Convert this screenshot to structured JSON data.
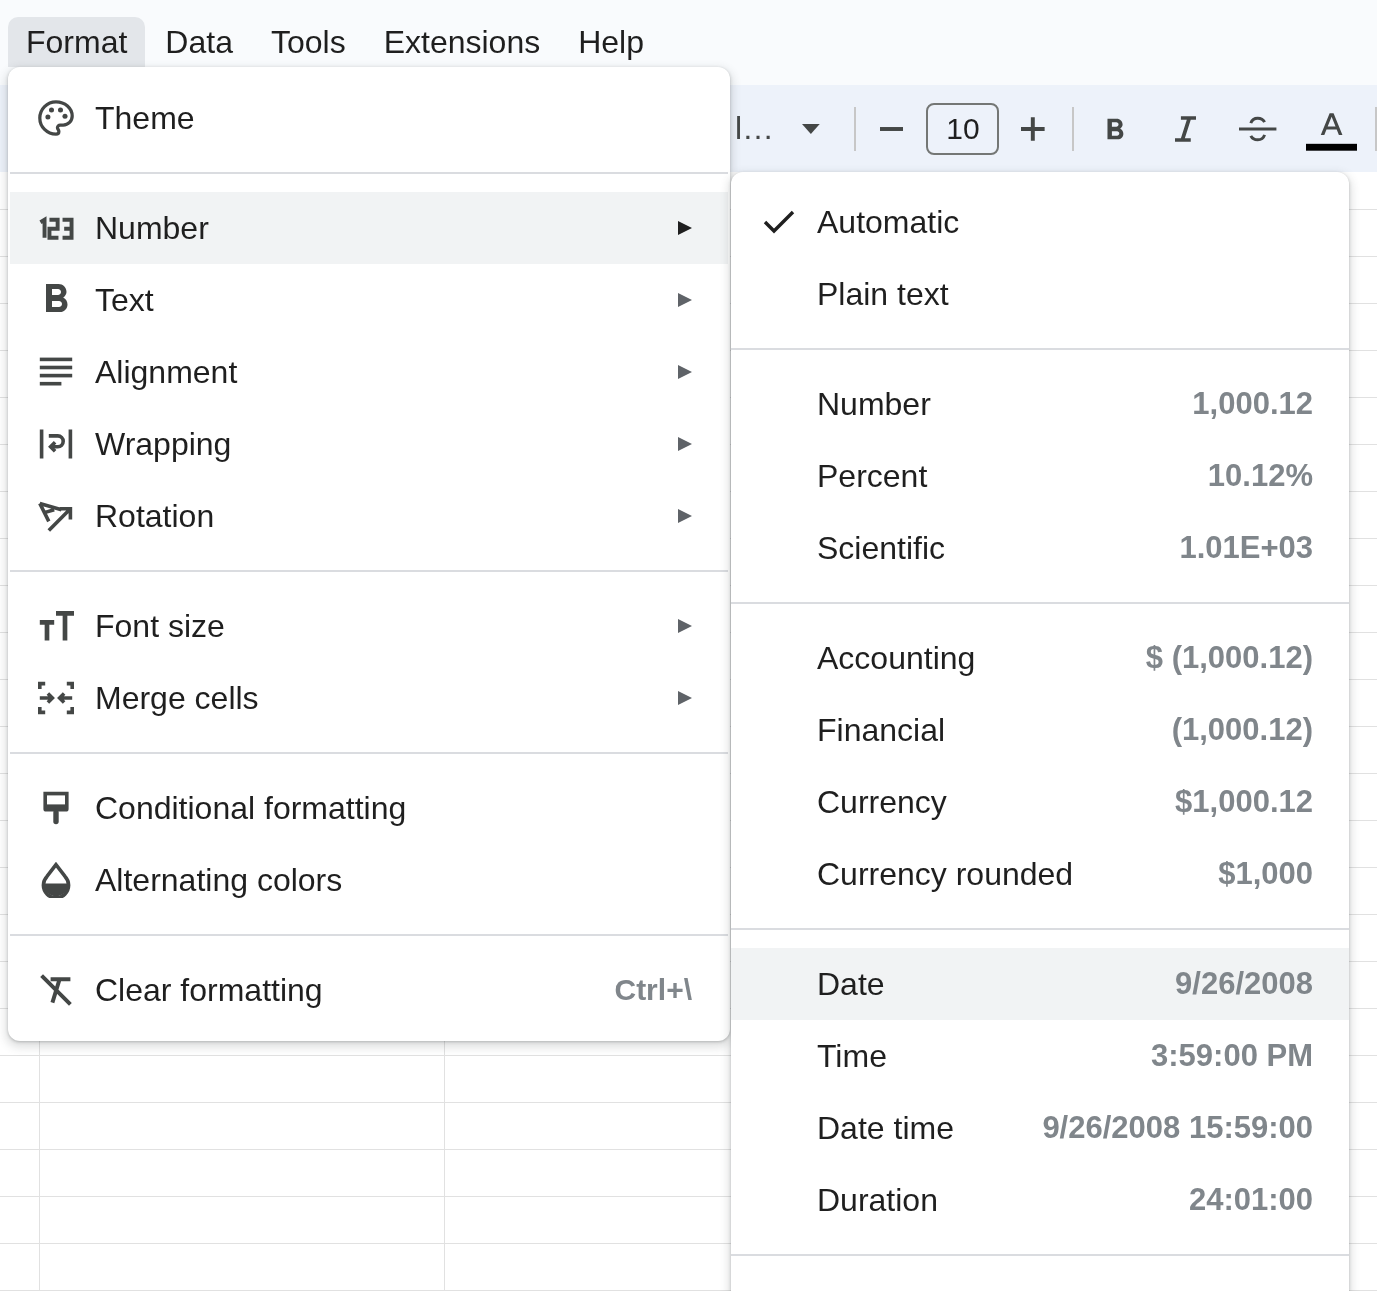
{
  "menu_bar": [
    {
      "label": "Format",
      "selected": true
    },
    {
      "label": "Data",
      "selected": false
    },
    {
      "label": "Tools",
      "selected": false
    },
    {
      "label": "Extensions",
      "selected": false
    },
    {
      "label": "Help",
      "selected": false
    }
  ],
  "toolbar": {
    "font_name": "l…",
    "font_size": "10"
  },
  "format_menu": {
    "sections": [
      {
        "items": [
          {
            "label": "Theme",
            "has_submenu": false,
            "selected": false
          }
        ]
      },
      {
        "items": [
          {
            "label": "Number",
            "has_submenu": true,
            "selected": true
          },
          {
            "label": "Text",
            "has_submenu": true,
            "selected": false
          },
          {
            "label": "Alignment",
            "has_submenu": true,
            "selected": false
          },
          {
            "label": "Wrapping",
            "has_submenu": true,
            "selected": false
          },
          {
            "label": "Rotation",
            "has_submenu": true,
            "selected": false
          }
        ]
      },
      {
        "items": [
          {
            "label": "Font size",
            "has_submenu": true,
            "selected": false
          },
          {
            "label": "Merge cells",
            "has_submenu": true,
            "selected": false
          }
        ]
      },
      {
        "items": [
          {
            "label": "Conditional formatting",
            "has_submenu": false,
            "selected": false
          },
          {
            "label": "Alternating colors",
            "has_submenu": false,
            "selected": false
          }
        ]
      },
      {
        "items": [
          {
            "label": "Clear formatting",
            "shortcut": "Ctrl+\\",
            "has_submenu": false,
            "selected": false
          }
        ]
      }
    ]
  },
  "number_submenu": {
    "sections": [
      {
        "items": [
          {
            "label": "Automatic",
            "checked": true,
            "selected": false
          },
          {
            "label": "Plain text",
            "checked": false,
            "selected": false
          }
        ]
      },
      {
        "items": [
          {
            "label": "Number",
            "value": "1,000.12",
            "checked": false,
            "selected": false
          },
          {
            "label": "Percent",
            "value": "10.12%",
            "checked": false,
            "selected": false
          },
          {
            "label": "Scientific",
            "value": "1.01E+03",
            "checked": false,
            "selected": false
          }
        ]
      },
      {
        "items": [
          {
            "label": "Accounting",
            "value": "$ (1,000.12)",
            "checked": false,
            "selected": false
          },
          {
            "label": "Financial",
            "value": "(1,000.12)",
            "checked": false,
            "selected": false
          },
          {
            "label": "Currency",
            "value": "$1,000.12",
            "checked": false,
            "selected": false
          },
          {
            "label": "Currency rounded",
            "value": "$1,000",
            "checked": false,
            "selected": false
          }
        ]
      },
      {
        "items": [
          {
            "label": "Date",
            "value": "9/26/2008",
            "checked": false,
            "selected": true
          },
          {
            "label": "Time",
            "value": "3:59:00 PM",
            "checked": false,
            "selected": false
          },
          {
            "label": "Date time",
            "value": "9/26/2008 15:59:00",
            "checked": false,
            "selected": false
          },
          {
            "label": "Duration",
            "value": "24:01:00",
            "checked": false,
            "selected": false
          }
        ]
      }
    ]
  }
}
